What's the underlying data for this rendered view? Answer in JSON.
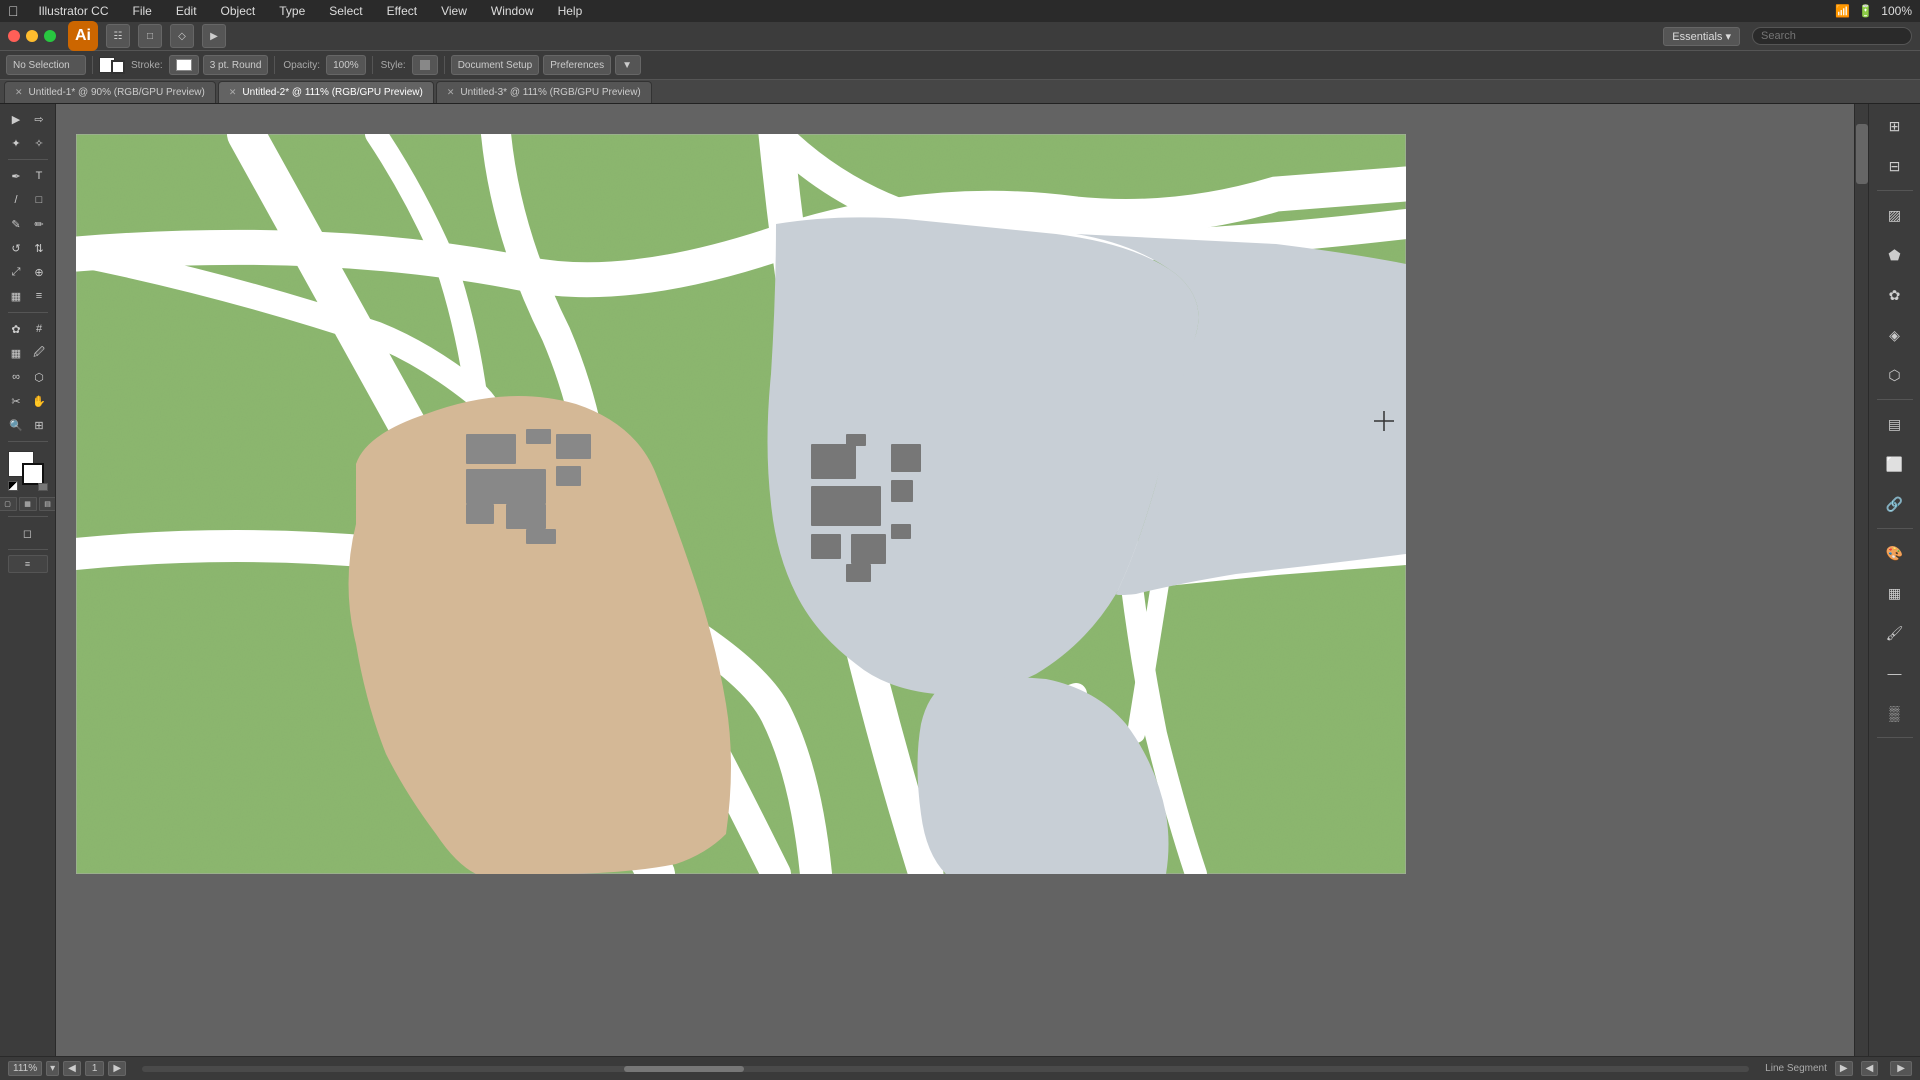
{
  "app": {
    "name": "Illustrator CC",
    "icon_label": "Ai"
  },
  "system_bar": {
    "apple": "⌘",
    "menus": [
      "Illustrator CC",
      "File",
      "Edit",
      "Object",
      "Type",
      "Select",
      "Effect",
      "View",
      "Window",
      "Help"
    ],
    "right_icons": [
      "wifi",
      "battery",
      "clock"
    ]
  },
  "title_bar": {
    "essentials_label": "Essentials ▾",
    "search_placeholder": "Search"
  },
  "toolbar": {
    "selection_label": "No Selection",
    "stroke_label": "Stroke:",
    "pt_label": "3 pt. Round",
    "opacity_label": "Opacity:",
    "opacity_value": "100%",
    "style_label": "Style:",
    "document_setup_label": "Document Setup",
    "preferences_label": "Preferences"
  },
  "tabs": [
    {
      "id": "tab1",
      "label": "Untitled-1* @ 90% (RGB/GPU Preview)",
      "active": false
    },
    {
      "id": "tab2",
      "label": "Untitled-2* @ 111% (RGB/GPU Preview)",
      "active": true
    },
    {
      "id": "tab3",
      "label": "Untitled-3* @ 111% (RGB/GPU Preview)",
      "active": false
    }
  ],
  "status_bar": {
    "zoom_value": "111%",
    "page_label": "1",
    "tool_name": "Line Segment"
  },
  "map": {
    "bg_color": "#8db870",
    "road_color": "#ffffff",
    "block1_color": "#d4b896",
    "block2_color": "#c8cfd6",
    "building_color": "#8a8a8a"
  }
}
